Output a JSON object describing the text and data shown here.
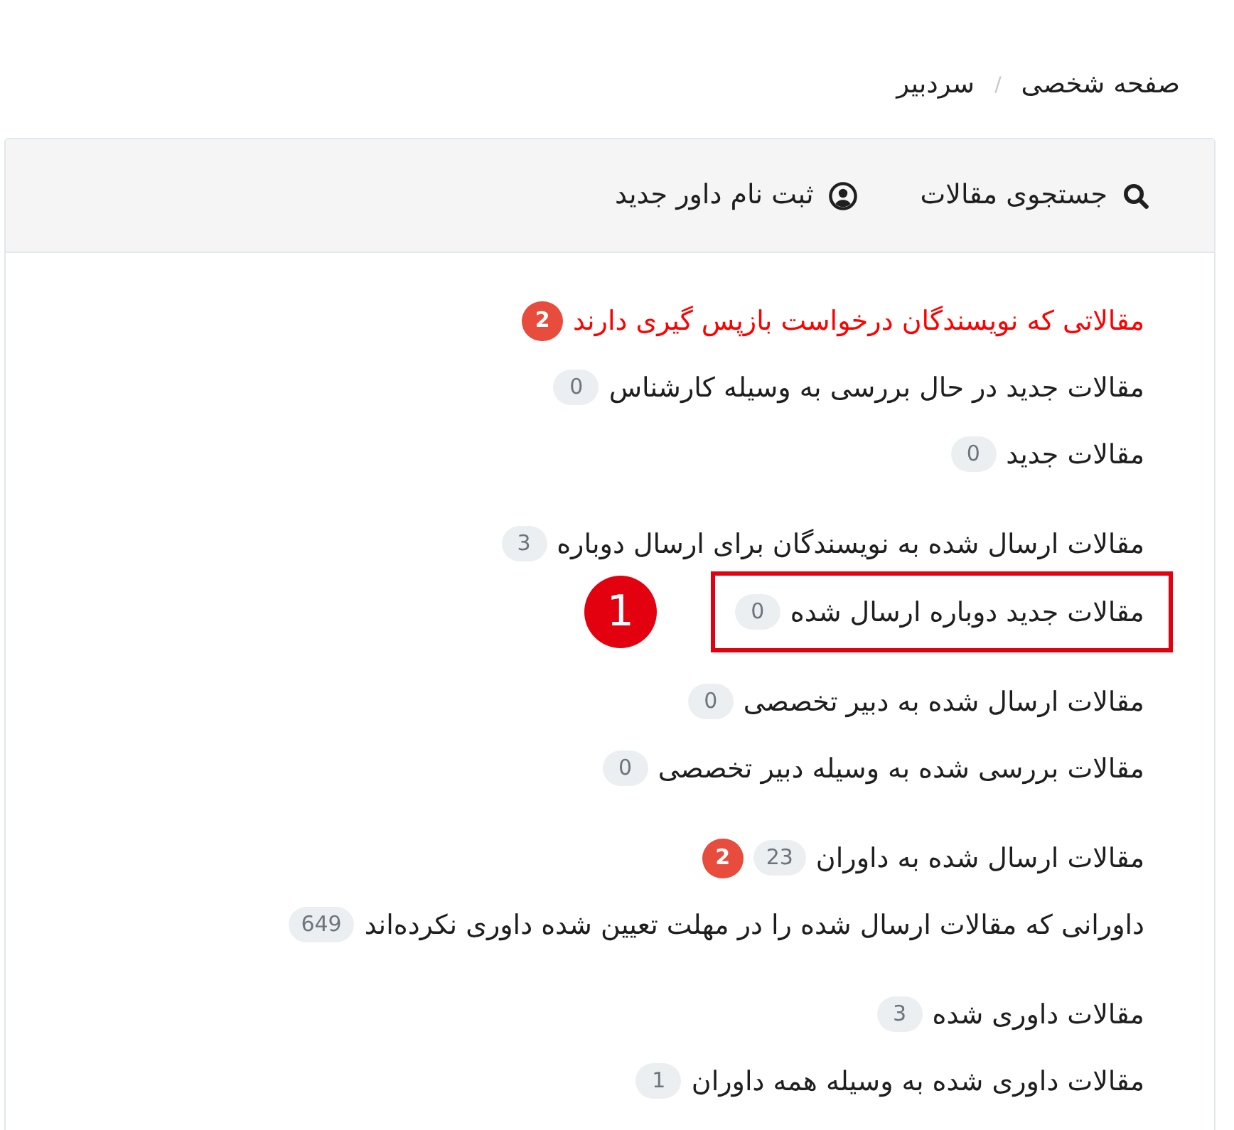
{
  "breadcrumb": {
    "items": [
      {
        "label": "صفحه شخصی"
      },
      {
        "label": "سردبیر"
      }
    ],
    "separator": "/"
  },
  "toolbar": [
    {
      "kind": "search",
      "label": "جستجوی مقالات"
    },
    {
      "kind": "user",
      "label": "ثبت نام داور جدید"
    }
  ],
  "groups": [
    {
      "items": [
        {
          "label": "مقالاتی که نویسندگان درخواست بازپس گیری دارند",
          "urgent": true,
          "highlighted": false,
          "badges": [
            {
              "kind": "alert",
              "text": "2"
            }
          ]
        },
        {
          "label": "مقالات جدید در حال بررسی به وسیله کارشناس",
          "urgent": false,
          "highlighted": false,
          "badges": [
            {
              "kind": "count",
              "text": "0"
            }
          ]
        },
        {
          "label": "مقالات جدید",
          "urgent": false,
          "highlighted": false,
          "badges": [
            {
              "kind": "count",
              "text": "0"
            }
          ]
        }
      ]
    },
    {
      "items": [
        {
          "label": "مقالات ارسال شده به نویسندگان برای ارسال دوباره",
          "urgent": false,
          "highlighted": false,
          "badges": [
            {
              "kind": "count",
              "text": "3"
            }
          ]
        },
        {
          "label": "مقالات جدید دوباره ارسال شده",
          "urgent": false,
          "highlighted": true,
          "callout": "1",
          "badges": [
            {
              "kind": "count",
              "text": "0"
            }
          ]
        },
        {
          "label": "مقالات ارسال شده به دبیر تخصصی",
          "urgent": false,
          "highlighted": false,
          "badges": [
            {
              "kind": "count",
              "text": "0"
            }
          ]
        },
        {
          "label": "مقالات بررسی شده به وسیله دبیر تخصصی",
          "urgent": false,
          "highlighted": false,
          "badges": [
            {
              "kind": "count",
              "text": "0"
            }
          ]
        }
      ]
    },
    {
      "items": [
        {
          "label": "مقالات ارسال شده به داوران",
          "urgent": false,
          "highlighted": false,
          "badges": [
            {
              "kind": "count",
              "text": "23"
            },
            {
              "kind": "alert",
              "text": "2"
            }
          ]
        },
        {
          "label": "داورانی که مقالات ارسال شده را در مهلت تعیین شده داوری نکرده‌اند",
          "urgent": false,
          "highlighted": false,
          "badges": [
            {
              "kind": "count",
              "text": "649"
            }
          ]
        }
      ]
    },
    {
      "items": [
        {
          "label": "مقالات داوری شده",
          "urgent": false,
          "highlighted": false,
          "badges": [
            {
              "kind": "count",
              "text": "3"
            }
          ]
        },
        {
          "label": "مقالات داوری شده به وسیله همه داوران",
          "urgent": false,
          "highlighted": false,
          "badges": [
            {
              "kind": "count",
              "text": "1"
            }
          ]
        }
      ]
    }
  ]
}
